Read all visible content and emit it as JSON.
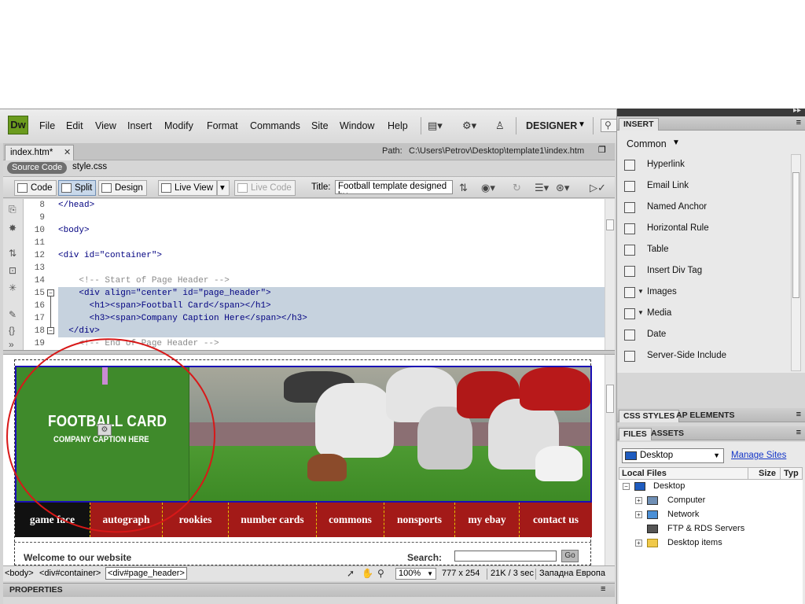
{
  "app": {
    "logo": "Dw",
    "workspace": "DESIGNER"
  },
  "menu": [
    "File",
    "Edit",
    "View",
    "Insert",
    "Modify",
    "Format",
    "Commands",
    "Site",
    "Window",
    "Help"
  ],
  "document": {
    "tab_label": "index.htm*",
    "path_label": "Path:",
    "path_value": "C:\\Users\\Petrov\\Desktop\\template1\\index.htm",
    "related_files": [
      "Source Code",
      "style.css"
    ],
    "toolbar": {
      "code": "Code",
      "split": "Split",
      "design": "Design",
      "live_view": "Live View",
      "live_code": "Live Code",
      "title_label": "Title:",
      "title_value": "Football template designed by"
    }
  },
  "code_lines": [
    {
      "num": "8",
      "text": "</head>"
    },
    {
      "num": "9",
      "text": ""
    },
    {
      "num": "10",
      "text": "<body>"
    },
    {
      "num": "11",
      "text": ""
    },
    {
      "num": "12",
      "text": "<div id=\"container\">"
    },
    {
      "num": "13",
      "text": ""
    },
    {
      "num": "14",
      "text": "    <!-- Start of Page Header -->"
    },
    {
      "num": "15",
      "text": "    <div align=\"center\" id=\"page_header\">"
    },
    {
      "num": "16",
      "text": "      <h1><span>Football Card</span></h1>"
    },
    {
      "num": "17",
      "text": "      <h3><span>Company Caption Here</span></h3>"
    },
    {
      "num": "18",
      "text": "  </div>"
    },
    {
      "num": "19",
      "text": "    <!-- End of Page Header -->"
    }
  ],
  "design_view": {
    "site_title": "FOOTBALL CARD",
    "site_caption": "COMPANY CAPTION HERE",
    "nav": [
      "game face",
      "autograph",
      "rookies",
      "number cards",
      "commons",
      "nonsports",
      "my ebay",
      "contact us"
    ],
    "welcome": "Welcome to our website",
    "search_label": "Search:",
    "go_label": "Go"
  },
  "statusbar": {
    "tags": [
      "<body>",
      "<div#container>",
      "<div#page_header>"
    ],
    "zoom": "100%",
    "window_size": "777 x 254",
    "file_size": "21K / 3 sec",
    "encoding": "Западна Европа"
  },
  "properties": {
    "label": "PROPERTIES"
  },
  "panels": {
    "insert_tab": "INSERT",
    "category": "Common",
    "insert_items": [
      {
        "label": "Hyperlink",
        "icon": "hyperlink-icon",
        "dropdown": false
      },
      {
        "label": "Email Link",
        "icon": "email-icon",
        "dropdown": false
      },
      {
        "label": "Named Anchor",
        "icon": "anchor-icon",
        "dropdown": false
      },
      {
        "label": "Horizontal Rule",
        "icon": "hr-icon",
        "dropdown": false
      },
      {
        "label": "Table",
        "icon": "table-icon",
        "dropdown": false
      },
      {
        "label": "Insert Div Tag",
        "icon": "div-icon",
        "dropdown": false
      },
      {
        "label": "Images",
        "icon": "image-icon",
        "dropdown": true
      },
      {
        "label": "Media",
        "icon": "media-icon",
        "dropdown": true
      },
      {
        "label": "Date",
        "icon": "calendar-icon",
        "dropdown": false
      },
      {
        "label": "Server-Side Include",
        "icon": "ssi-icon",
        "dropdown": false
      }
    ],
    "css_styles_tab": "CSS STYLES",
    "ap_elements_tab": "AP ELEMENTS",
    "files_tab": "FILES",
    "assets_tab": "ASSETS",
    "site_select": "Desktop",
    "manage_sites": "Manage Sites",
    "columns": [
      "Local Files",
      "Size",
      "Typ"
    ],
    "files": [
      {
        "label": "Desktop",
        "level": 0,
        "toggle": "−",
        "icon": "desktop-icon"
      },
      {
        "label": "Computer",
        "level": 1,
        "toggle": "+",
        "icon": "computer-icon"
      },
      {
        "label": "Network",
        "level": 1,
        "toggle": "+",
        "icon": "network-icon"
      },
      {
        "label": "FTP & RDS Servers",
        "level": 1,
        "toggle": "",
        "icon": "server-icon"
      },
      {
        "label": "Desktop items",
        "level": 1,
        "toggle": "+",
        "icon": "folder-icon"
      }
    ]
  },
  "colors": {
    "header_green": "#3f8a2b",
    "nav_red": "#a31a18",
    "annotation_red": "#d81818",
    "selection": "#c6d2de"
  }
}
